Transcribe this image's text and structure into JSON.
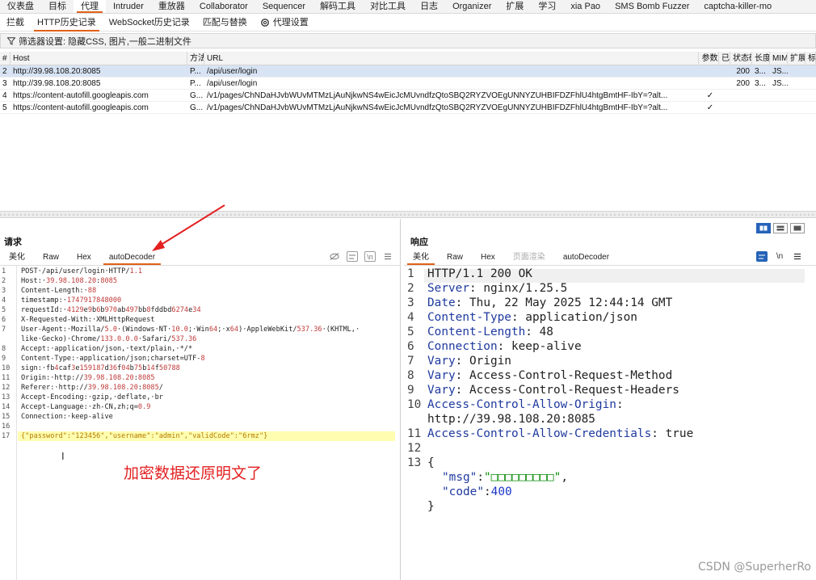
{
  "top_tabs": [
    "仪表盘",
    "目标",
    "代理",
    "Intruder",
    "重放器",
    "Collaborator",
    "Sequencer",
    "解码工具",
    "对比工具",
    "日志",
    "Organizer",
    "扩展",
    "学习",
    "xia Pao",
    "SMS Bomb Fuzzer",
    "captcha-killer-mo"
  ],
  "sub_tabs": {
    "intercept": "拦截",
    "http_history": "HTTP历史记录",
    "websocket_history": "WebSocket历史记录",
    "match_replace": "匹配与替换",
    "proxy_settings": "代理设置"
  },
  "filter": {
    "text": "筛选器设置: 隐藏CSS, 图片,一般二进制文件"
  },
  "history_table": {
    "columns": [
      "#",
      "Host",
      "方法",
      "URL",
      "参数",
      "已编",
      "状态码",
      "长度",
      "MIME",
      "扩展",
      "标"
    ],
    "rows": [
      {
        "num": "2",
        "host": "http://39.98.108.20:8085",
        "method": "P...",
        "url": "/api/user/login",
        "params": "",
        "edited": "",
        "status": "200",
        "length": "3...",
        "mime": "JS...",
        "selected": true
      },
      {
        "num": "3",
        "host": "http://39.98.108.20:8085",
        "method": "P...",
        "url": "/api/user/login",
        "params": "",
        "edited": "",
        "status": "200",
        "length": "3...",
        "mime": "JS...",
        "selected": false
      },
      {
        "num": "4",
        "host": "https://content-autofill.googleapis.com",
        "method": "G...",
        "url": "/v1/pages/ChNDaHJvbWUvMTMzLjAuNjkwNS4wEicJcMUvndfzQtoSBQ2RYZVOEgUNNYZUHBIFDZFhlU4htgBmtHF-IbY=?alt...",
        "params": "✓",
        "edited": "",
        "status": "",
        "length": "",
        "mime": "",
        "selected": false
      },
      {
        "num": "5",
        "host": "https://content-autofill.googleapis.com",
        "method": "G...",
        "url": "/v1/pages/ChNDaHJvbWUvMTMzLjAuNjkwNS4wEicJcMUvndfzQtoSBQ2RYZVOEgUNNYZUHBIFDZFhlU4htgBmtHF-IbY=?alt...",
        "params": "✓",
        "edited": "",
        "status": "",
        "length": "",
        "mime": "",
        "selected": false
      }
    ]
  },
  "request": {
    "title": "请求",
    "tabs": {
      "pretty": "美化",
      "raw": "Raw",
      "hex": "Hex",
      "autodecoder": "autoDecoder"
    },
    "lines": [
      {
        "n": "1",
        "text": "POST·/api/user/login·HTTP/1.1"
      },
      {
        "n": "2",
        "text": "Host:·39.98.108.20:8085"
      },
      {
        "n": "3",
        "text": "Content-Length:·88"
      },
      {
        "n": "4",
        "text": "timestamp:·1747917848000"
      },
      {
        "n": "5",
        "text": "requestId:·4129e9b6b970ab497bb8fddbd6274e34"
      },
      {
        "n": "6",
        "text": "X-Requested-With:·XMLHttpRequest"
      },
      {
        "n": "7",
        "text": "User-Agent:·Mozilla/5.0·(Windows·NT·10.0;·Win64;·x64)·AppleWebKit/537.36·(KHTML,·"
      },
      {
        "n": "",
        "text": "like·Gecko)·Chrome/133.0.0.0·Safari/537.36"
      },
      {
        "n": "8",
        "text": "Accept:·application/json,·text/plain,·*/*"
      },
      {
        "n": "9",
        "text": "Content-Type:·application/json;charset=UTF-8"
      },
      {
        "n": "10",
        "text": "sign:·fb4caf3e159187d36f04b75b14f50788"
      },
      {
        "n": "11",
        "text": "Origin:·http://39.98.108.20:8085"
      },
      {
        "n": "12",
        "text": "Referer:·http://39.98.108.20:8085/"
      },
      {
        "n": "13",
        "text": "Accept-Encoding:·gzip,·deflate,·br"
      },
      {
        "n": "14",
        "text": "Accept-Language:·zh-CN,zh;q=0.9"
      },
      {
        "n": "15",
        "text": "Connection:·keep-alive"
      },
      {
        "n": "16",
        "text": ""
      },
      {
        "n": "17",
        "text": "{\"password\":\"123456\",\"username\":\"admin\",\"validCode\":\"6rmz\"}"
      }
    ],
    "annotation": "加密数据还原明文了"
  },
  "response": {
    "title": "响应",
    "tabs": {
      "pretty": "美化",
      "raw": "Raw",
      "hex": "Hex",
      "render": "页面渲染",
      "autodecoder": "autoDecoder"
    },
    "lines": [
      {
        "n": "1",
        "text": "HTTP/1.1 200 OK"
      },
      {
        "n": "2",
        "key": "Server",
        "val": " nginx/1.25.5"
      },
      {
        "n": "3",
        "key": "Date",
        "val": " Thu, 22 May 2025 12:44:14 GMT"
      },
      {
        "n": "4",
        "key": "Content-Type",
        "val": " application/json"
      },
      {
        "n": "5",
        "key": "Content-Length",
        "val": " 48"
      },
      {
        "n": "6",
        "key": "Connection",
        "val": " keep-alive"
      },
      {
        "n": "7",
        "key": "Vary",
        "val": " Origin"
      },
      {
        "n": "8",
        "key": "Vary",
        "val": " Access-Control-Request-Method"
      },
      {
        "n": "9",
        "key": "Vary",
        "val": " Access-Control-Request-Headers"
      },
      {
        "n": "10",
        "key": "Access-Control-Allow-Origin",
        "val": ""
      },
      {
        "n": "",
        "text": "http://39.98.108.20:8085"
      },
      {
        "n": "11",
        "key": "Access-Control-Allow-Credentials",
        "val": " true"
      },
      {
        "n": "12",
        "text": ""
      },
      {
        "n": "13",
        "text": "{"
      },
      {
        "n": "",
        "json_key": "\"msg\"",
        "json_val": "\"□□□□□□□□□\"",
        "json_sep": ":",
        "json_end": ","
      },
      {
        "n": "",
        "json_key": "\"code\"",
        "json_val": "400",
        "json_sep": ":",
        "json_end": ""
      },
      {
        "n": "",
        "text": "}"
      }
    ]
  },
  "watermark": "CSDN @SuperherRo",
  "colors": {
    "accent": "#e0601a",
    "selected_row": "#d8e4f4",
    "annotation": "#e32020",
    "blue_button": "#2563b8"
  }
}
